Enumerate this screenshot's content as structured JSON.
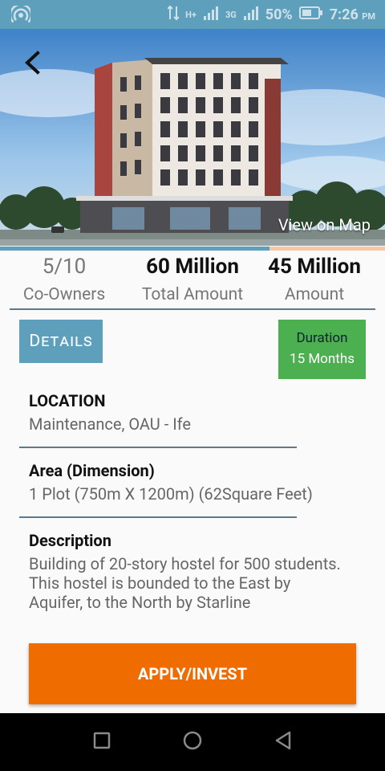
{
  "status_bar": {
    "battery_percent": "50%",
    "time": "7:26",
    "time_suffix": "PM",
    "network": "3G",
    "signal_type": "H+"
  },
  "hero": {
    "view_on_map": "View on Map"
  },
  "progress": {
    "fraction": 0.7
  },
  "stats": [
    {
      "value": "5/10",
      "label": "Co-Owners"
    },
    {
      "value": "60 Million",
      "label": "Total Amount"
    },
    {
      "value": "45 Million",
      "label": "Amount"
    }
  ],
  "details_button": "Details",
  "duration": {
    "label": "Duration",
    "value": "15 Months"
  },
  "location": {
    "title": "LOCATION",
    "text": "Maintenance, OAU - Ife"
  },
  "area": {
    "title": "Area (Dimension)",
    "text": "1 Plot (750m X 1200m) (62Square Feet)"
  },
  "description": {
    "title": "Description",
    "lines": [
      "Building of 20-story hostel for 500 students.",
      "This hostel is bounded to the East by",
      "Aquifer, to the North by Starline"
    ]
  },
  "apply_button": "APPLY/INVEST",
  "colors": {
    "accent": "#5e9fbc",
    "apply": "#ef6c00",
    "duration": "#4cb050"
  }
}
